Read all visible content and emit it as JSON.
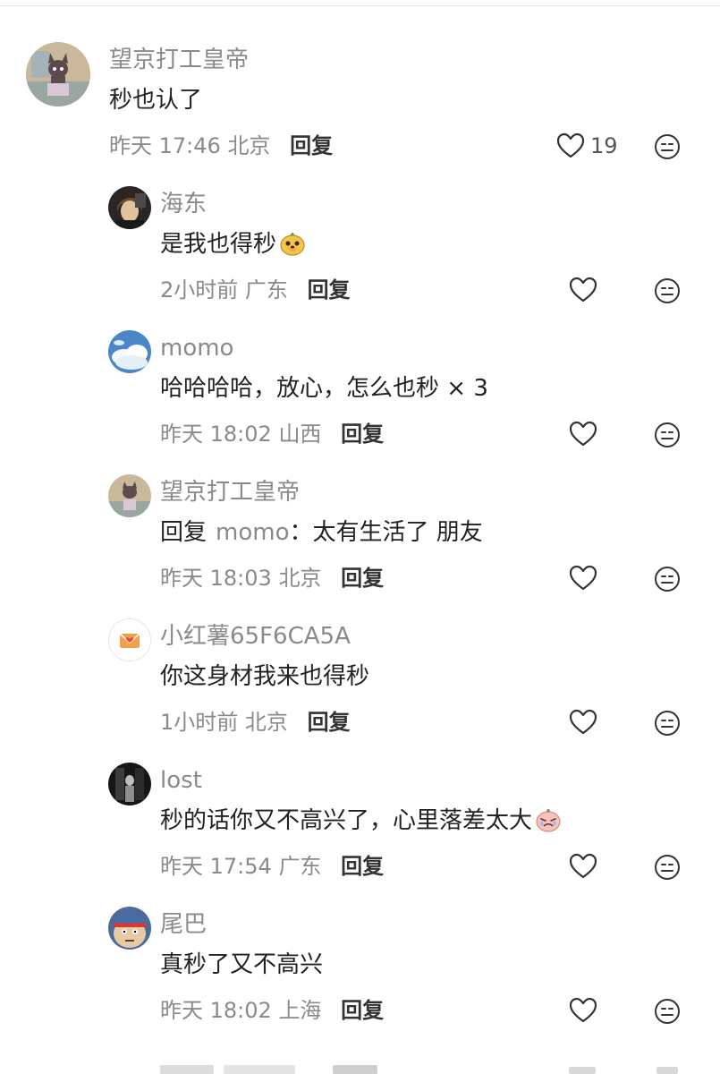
{
  "comments": [
    {
      "username": "望京打工皇帝",
      "text": "秒也认了",
      "time": "昨天 17:46",
      "location": "北京",
      "reply_label": "回复",
      "like_count": "19"
    },
    {
      "username": "海东",
      "text": "是我也得秒",
      "time": "2小时前",
      "location": "广东",
      "reply_label": "回复",
      "like_count": ""
    },
    {
      "username": "momo",
      "text": "哈哈哈哈，放心，怎么也秒 × 3",
      "time": "昨天 18:02",
      "location": "山西",
      "reply_label": "回复",
      "like_count": ""
    },
    {
      "username": "望京打工皇帝",
      "reply_prefix": "回复",
      "reply_target": "momo",
      "reply_colon": "：",
      "text": "太有生活了 朋友",
      "time": "昨天 18:03",
      "location": "北京",
      "reply_label": "回复",
      "like_count": ""
    },
    {
      "username": "小红薯65F6CA5A",
      "text": "你这身材我来也得秒",
      "time": "1小时前",
      "location": "北京",
      "reply_label": "回复",
      "like_count": ""
    },
    {
      "username": "lost",
      "text": "秒的话你又不高兴了，心里落差太大",
      "time": "昨天 17:54",
      "location": "广东",
      "reply_label": "回复",
      "like_count": ""
    },
    {
      "username": "尾巴",
      "text": "真秒了又不高兴",
      "time": "昨天 18:02",
      "location": "上海",
      "reply_label": "回复",
      "like_count": ""
    }
  ],
  "icons": {
    "like": "heart-outline-icon",
    "dislike": "meh-face-icon",
    "emoji_1": "dog-face-emoji",
    "emoji_2": "crying-peach-emoji"
  },
  "colors": {
    "text_primary": "#222222",
    "text_secondary": "#8a8a8a",
    "icon_stroke": "#333333"
  }
}
